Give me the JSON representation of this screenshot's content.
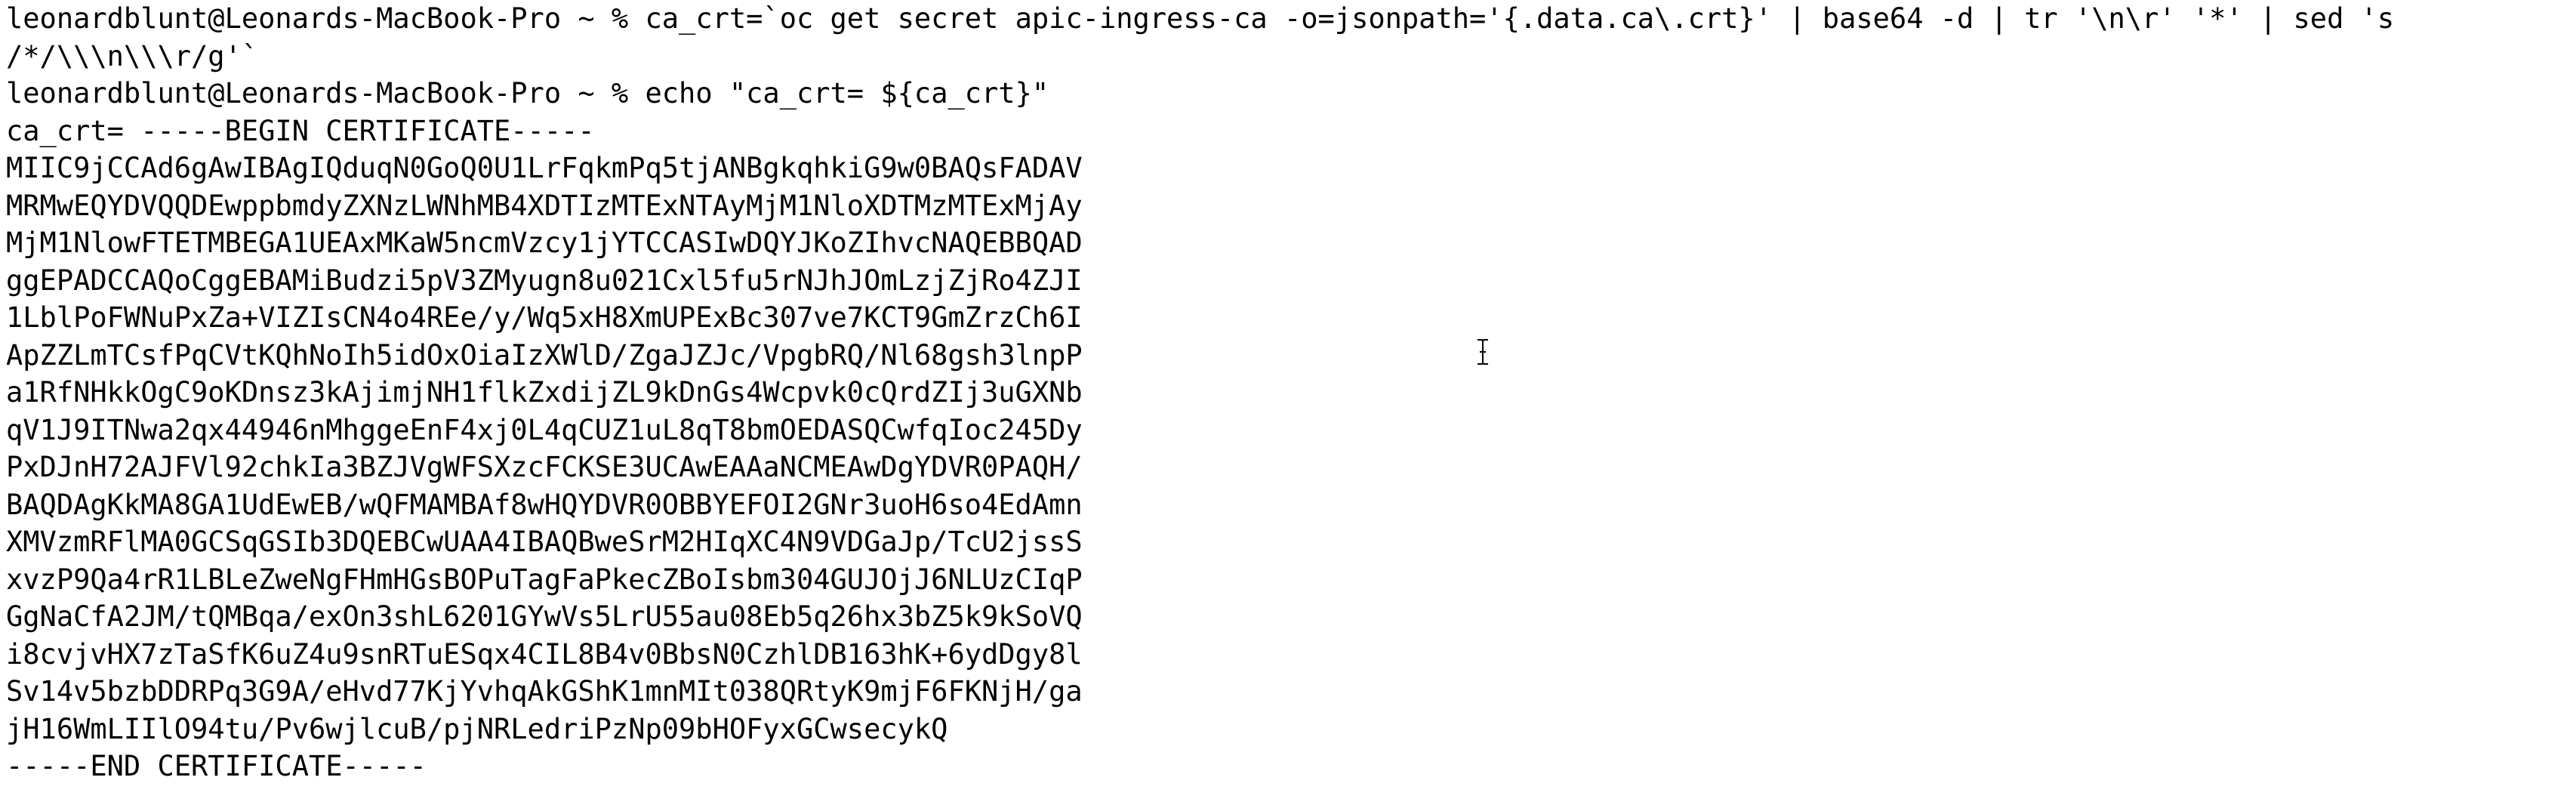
{
  "terminal": {
    "prompt": "leonardblunt@Leonards-MacBook-Pro ~ %",
    "commands": [
      {
        "text": "ca_crt=`oc get secret apic-ingress-ca -o=jsonpath='{.data.ca\\.crt}' | base64 -d | tr '\\n\\r' '*' | sed 's",
        "continuation": "/*/\\\\\\n\\\\\\r/g'`"
      },
      {
        "text": "echo \"ca_crt= ${ca_crt}\""
      }
    ],
    "output": [
      "ca_crt= -----BEGIN CERTIFICATE-----",
      "MIIC9jCCAd6gAwIBAgIQduqN0GoQ0U1LrFqkmPq5tjANBgkqhkiG9w0BAQsFADAV",
      "MRMwEQYDVQQDEwppbmdyZXNzLWNhMB4XDTIzMTExNTAyMjM1NloXDTMzMTExMjAy",
      "MjM1NlowFTETMBEGA1UEAxMKaW5ncmVzcy1jYTCCASIwDQYJKoZIhvcNAQEBBQAD",
      "ggEPADCCAQoCggEBAMiBudzi5pV3ZMyugn8u021Cxl5fu5rNJhJOmLzjZjRo4ZJI",
      "1LblPoFWNuPxZa+VIZIsCN4o4REe/y/Wq5xH8XmUPExBc307ve7KCT9GmZrzCh6I",
      "ApZZLmTCsfPqCVtKQhNoIh5idOxOiaIzXWlD/ZgaJZJc/VpgbRQ/Nl68gsh3lnpP",
      "a1RfNHkkOgC9oKDnsz3kAjimjNH1flkZxdijZL9kDnGs4Wcpvk0cQrdZIj3uGXNb",
      "qV1J9ITNwa2qx44946nMhggeEnF4xj0L4qCUZ1uL8qT8bmOEDASQCwfqIoc245Dy",
      "PxDJnH72AJFVl92chkIa3BZJVgWFSXzcFCKSE3UCAwEAAaNCMEAwDgYDVR0PAQH/",
      "BAQDAgKkMA8GA1UdEwEB/wQFMAMBAf8wHQYDVR0OBBYEFOI2GNr3uoH6so4EdAmn",
      "XMVzmRFlMA0GCSqGSIb3DQEBCwUAA4IBAQBweSrM2HIqXC4N9VDGaJp/TcU2jssS",
      "xvzP9Qa4rR1LBLeZweNgFHmHGsBOPuTagFaPkecZBoIsbm304GUJOjJ6NLUzCIqP",
      "GgNaCfA2JM/tQMBqa/exOn3shL6201GYwVs5LrU55au08Eb5q26hx3bZ5k9kSoVQ",
      "i8cvjvHX7zTaSfK6uZ4u9snRTuESqx4CIL8B4v0BbsN0CzhlDB163hK+6ydDgy8l",
      "Sv14v5bzbDDRPq3G9A/eHvd77KjYvhqAkGShK1mnMIt038QRtyK9mjF6FKNjH/ga",
      "jH16WmLIIlO94tu/Pv6wjlcuB/pjNRLedriPzNp09bHOFyxGCwsecykQ",
      "-----END CERTIFICATE-----"
    ]
  },
  "cursor": {
    "icon": "ibeam-cursor-icon"
  }
}
